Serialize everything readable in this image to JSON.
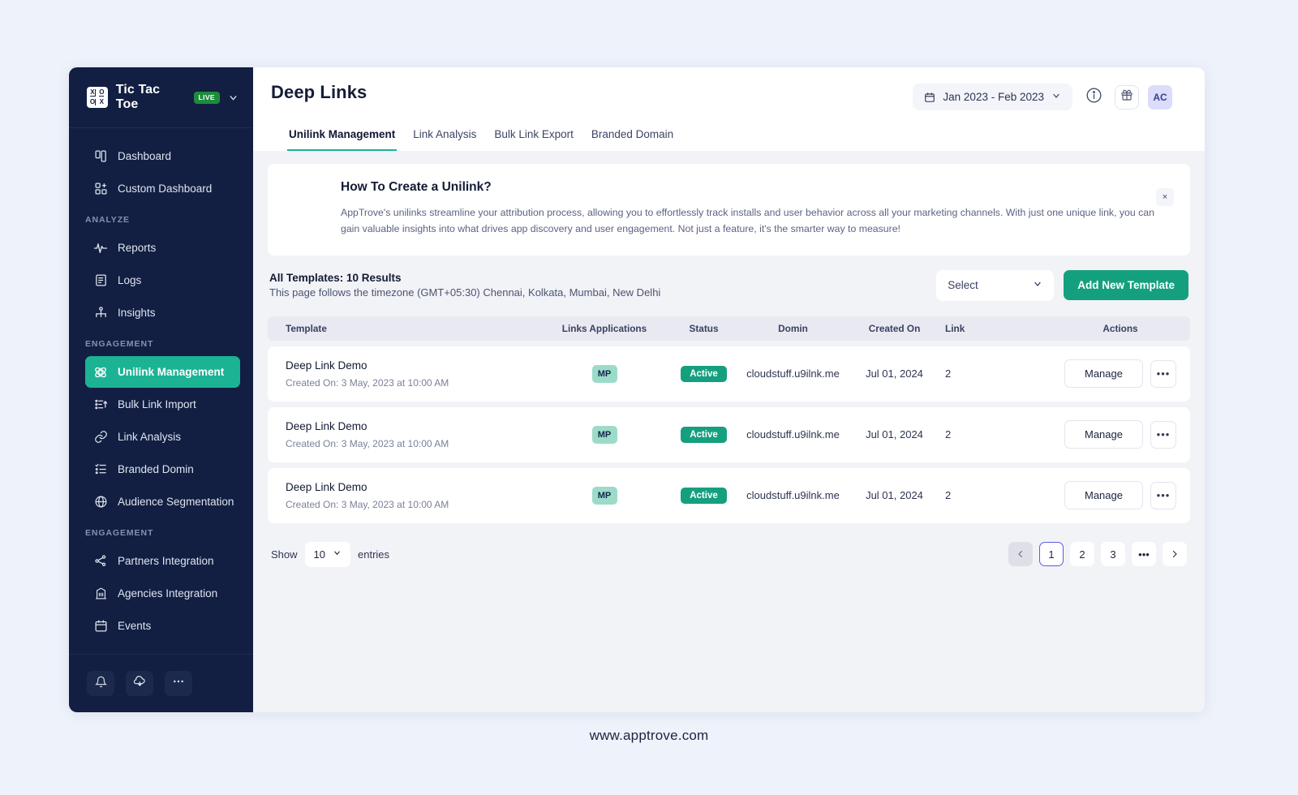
{
  "sidebar": {
    "brand": {
      "name": "Tic Tac Toe",
      "badge": "LIVE",
      "logo_cells": [
        "X",
        "O",
        "O",
        "X"
      ]
    },
    "items": [
      {
        "label": "Dashboard",
        "icon": "dashboard-icon",
        "active": false
      },
      {
        "label": "Custom Dashboard",
        "icon": "custom-dashboard-icon",
        "active": false
      }
    ],
    "sections": [
      {
        "title": "ANALYZE",
        "items": [
          {
            "label": "Reports",
            "icon": "pulse-icon"
          },
          {
            "label": "Logs",
            "icon": "log-file-icon"
          },
          {
            "label": "Insights",
            "icon": "insights-icon"
          }
        ]
      },
      {
        "title": "ENGAGEMENT",
        "items": [
          {
            "label": "Unilink Management",
            "icon": "unilink-icon",
            "active": true
          },
          {
            "label": "Bulk Link Import",
            "icon": "bulk-import-icon"
          },
          {
            "label": "Link Analysis",
            "icon": "link-icon"
          },
          {
            "label": "Branded Domin",
            "icon": "checklist-icon"
          },
          {
            "label": "Audience Segmentation",
            "icon": "globe-icon"
          }
        ]
      },
      {
        "title": "ENGAGEMENT",
        "items": [
          {
            "label": "Partners Integration",
            "icon": "share-nodes-icon"
          },
          {
            "label": "Agencies Integration",
            "icon": "building-icon"
          },
          {
            "label": "Events",
            "icon": "calendar-icon"
          }
        ]
      }
    ],
    "footer_buttons": [
      {
        "name": "notifications-button",
        "icon": "bell-icon"
      },
      {
        "name": "cloud-download-button",
        "icon": "cloud-download-icon"
      },
      {
        "name": "more-options-button",
        "icon": "ellipsis-icon"
      }
    ]
  },
  "header": {
    "title": "Deep Links",
    "date_range": "Jan 2023 - Feb 2023",
    "avatar_initials": "AC",
    "tabs": [
      {
        "label": "Unilink Management",
        "active": true
      },
      {
        "label": "Link Analysis",
        "active": false
      },
      {
        "label": "Bulk Link Export",
        "active": false
      },
      {
        "label": "Branded Domain",
        "active": false
      }
    ]
  },
  "banner": {
    "title": "How To Create a Unilink?",
    "body": "AppTrove's unilinks streamline your attribution process, allowing you to effortlessly track installs and user behavior across all your marketing channels. With just one unique link, you can gain valuable insights into what drives app discovery and user engagement. Not just a feature, it's the smarter way to measure!",
    "close_label": "×"
  },
  "toolbar": {
    "results_title": "All Templates: 10 Results",
    "timezone_note": "This page follows the timezone (GMT+05:30) Chennai, Kolkata, Mumbai, New Delhi",
    "select_label": "Select",
    "add_button": "Add New Template"
  },
  "table": {
    "columns": [
      "Template",
      "Links Applications",
      "Status",
      "Domin",
      "Created On",
      "Link",
      "Actions"
    ],
    "rows": [
      {
        "template": "Deep Link Demo",
        "created_on_sub": "Created On: 3 May, 2023 at 10:00 AM",
        "links_application": "MP",
        "status": "Active",
        "domin": "cloudstuff.u9ilnk.me",
        "created_on": "Jul 01, 2024",
        "link": "2",
        "manage_label": "Manage",
        "more_label": "•••"
      },
      {
        "template": "Deep Link Demo",
        "created_on_sub": "Created On: 3 May, 2023 at 10:00 AM",
        "links_application": "MP",
        "status": "Active",
        "domin": "cloudstuff.u9ilnk.me",
        "created_on": "Jul 01, 2024",
        "link": "2",
        "manage_label": "Manage",
        "more_label": "•••"
      },
      {
        "template": "Deep Link Demo",
        "created_on_sub": "Created On: 3 May, 2023 at 10:00 AM",
        "links_application": "MP",
        "status": "Active",
        "domin": "cloudstuff.u9ilnk.me",
        "created_on": "Jul 01, 2024",
        "link": "2",
        "manage_label": "Manage",
        "more_label": "•••"
      }
    ]
  },
  "pagination": {
    "show_label": "Show",
    "entries_value": "10",
    "entries_label": "entries",
    "prev": "‹",
    "next": "›",
    "pages": [
      "1",
      "2",
      "3",
      "•••"
    ],
    "current_page": "1"
  },
  "footer": {
    "url": "www.apptrove.com"
  },
  "colors": {
    "sidebar_bg": "#121f42",
    "accent_green": "#1bb394",
    "primary_green": "#14a07e",
    "page_bg": "#eef2fb",
    "avatar_bg": "#dcdcfb",
    "live_badge": "#1c8c3c"
  }
}
